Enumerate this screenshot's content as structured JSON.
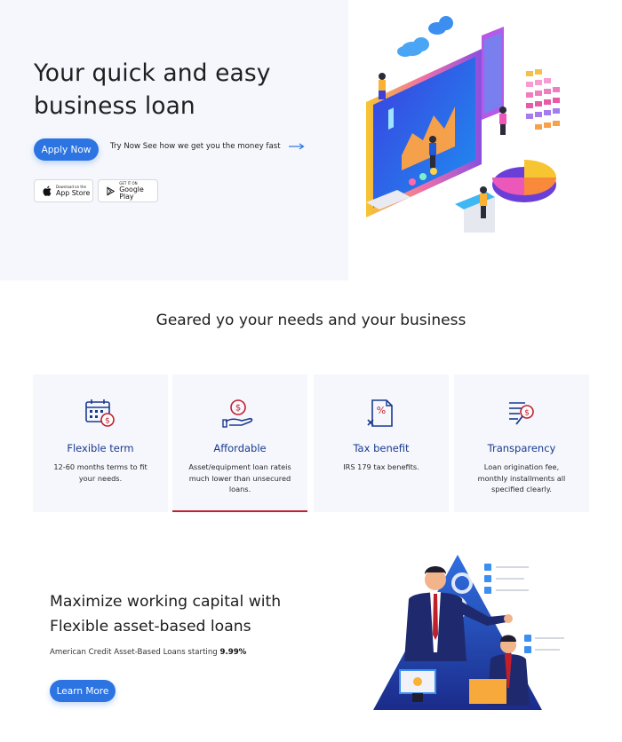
{
  "hero": {
    "title": "Your quick and easy business loan",
    "apply_label": "Apply Now",
    "try_label": "Try Now See how we get you the money fast",
    "appstore_small": "Download on the",
    "appstore_big": "App Store",
    "gplay_small": "GET IT ON",
    "gplay_big": "Google Play"
  },
  "features": {
    "title": "Geared yo your needs and your business",
    "cards": [
      {
        "title": "Flexible term",
        "desc": "12-60 months terms to fit your needs.",
        "icon": "calendar-dollar-icon"
      },
      {
        "title": "Affordable",
        "desc": "Asset/equipment loan rateis much lower than unsecured loans.",
        "icon": "hand-coin-icon"
      },
      {
        "title": "Tax benefit",
        "desc": "IRS 179 tax benefits.",
        "icon": "tax-document-icon"
      },
      {
        "title": "Transparency",
        "desc": "Loan origination fee, monthly installments all specified clearly.",
        "icon": "list-dollar-icon"
      }
    ]
  },
  "maximize": {
    "title": "Maximize working capital with Flexible asset-based loans",
    "sub_prefix": "American Credit Asset-Based Loans starting",
    "sub_rate": "9.99%",
    "learn_label": "Learn More"
  },
  "colors": {
    "primary": "#2b74e2",
    "navy": "#1a3a8f",
    "accent_red": "#c21f2d",
    "section_bg": "#f5f7fc"
  }
}
